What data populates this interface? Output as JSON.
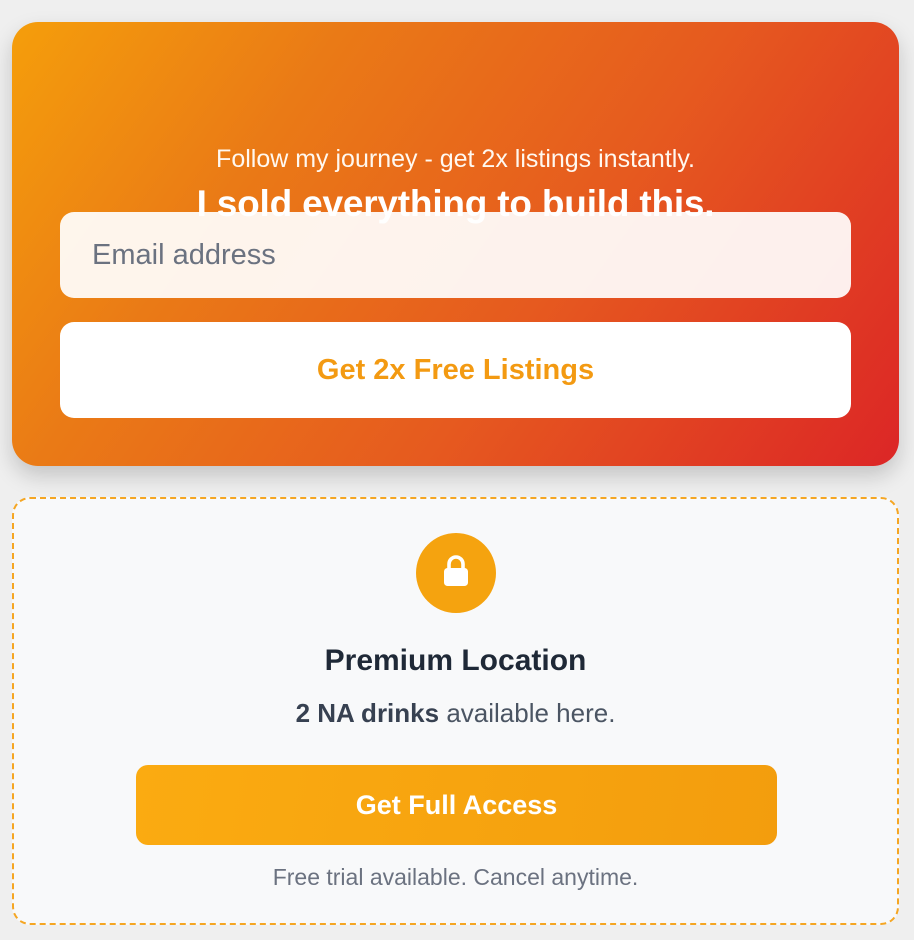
{
  "promo": {
    "title": "I sold everything to build this.",
    "subtitle": "Follow my journey - get 2x listings instantly.",
    "email_placeholder": "Email address",
    "email_value": "",
    "button_label": "Get 2x Free Listings"
  },
  "premium": {
    "icon": "lock-icon",
    "title": "Premium Location",
    "desc_strong": "2 NA drinks",
    "desc_rest": " available here.",
    "button_label": "Get Full Access",
    "note": "Free trial available. Cancel anytime."
  },
  "colors": {
    "gradient_start": "#f59e0b",
    "gradient_end": "#dc2626",
    "accent_orange": "#f39a12",
    "dashed_border": "#f5a623",
    "page_bg": "#efefef"
  }
}
